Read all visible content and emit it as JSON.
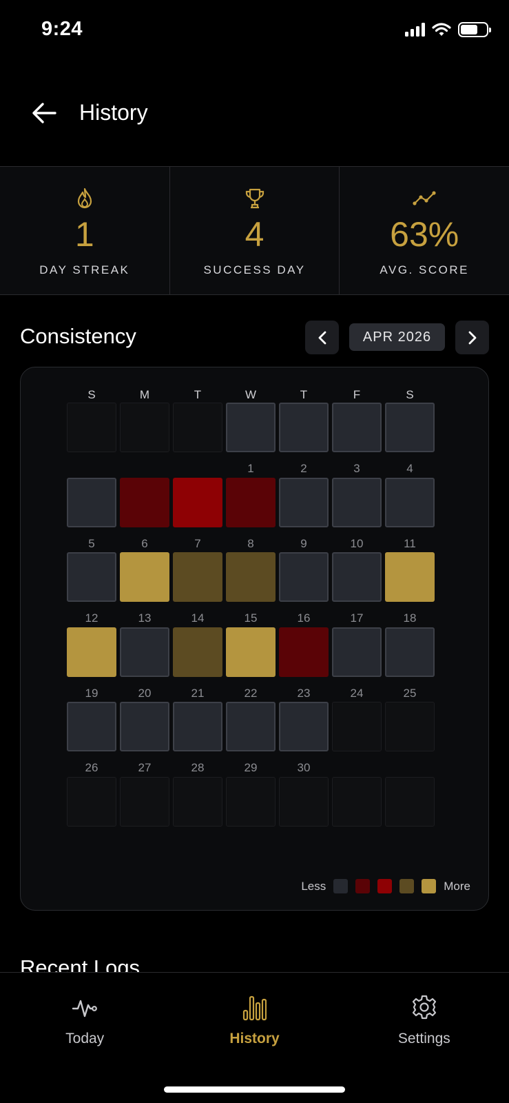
{
  "status_bar": {
    "time": "9:24"
  },
  "header": {
    "title": "History",
    "back_icon": "arrow-left-icon"
  },
  "stats": [
    {
      "icon": "flame-icon",
      "value": "1",
      "label": "DAY STREAK"
    },
    {
      "icon": "trophy-icon",
      "value": "4",
      "label": "SUCCESS DAY"
    },
    {
      "icon": "trend-line-icon",
      "value": "63%",
      "label": "AVG. SCORE"
    }
  ],
  "consistency": {
    "title": "Consistency",
    "month_label": "APR 2026",
    "weekdays": [
      "S",
      "M",
      "T",
      "W",
      "T",
      "F",
      "S"
    ],
    "first_weekday_index": 3,
    "days_in_month": 30,
    "levels": [
      0,
      0,
      0,
      0,
      0,
      1,
      2,
      1,
      0,
      0,
      0,
      0,
      4,
      3,
      3,
      0,
      0,
      4,
      4,
      0,
      3,
      4,
      1,
      0,
      0,
      0,
      0,
      0,
      0,
      0
    ],
    "legend": {
      "less": "Less",
      "more": "More"
    },
    "level_colors": [
      "#262930",
      "#5a0306",
      "#8e0104",
      "#5c4b22",
      "#b4953f"
    ]
  },
  "recent_logs": {
    "title": "Recent Logs"
  },
  "tabs": [
    {
      "label": "Today",
      "icon": "pulse-icon",
      "active": false
    },
    {
      "label": "History",
      "icon": "bar-chart-icon",
      "active": true
    },
    {
      "label": "Settings",
      "icon": "gear-icon",
      "active": false
    }
  ],
  "accent_color": "#c7a13f"
}
